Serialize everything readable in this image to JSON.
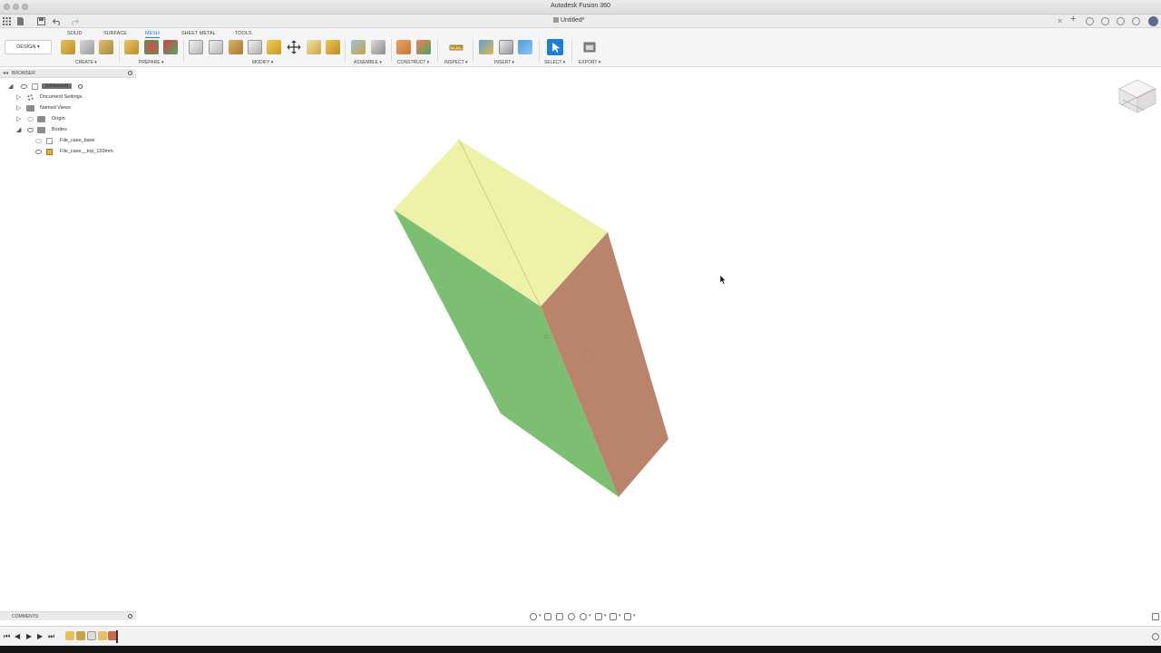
{
  "window": {
    "title": "Autodesk Fusion 360"
  },
  "document_tab": {
    "title": "Untitled*"
  },
  "workspace_tabs": [
    "SOLID",
    "SURFACE",
    "MESH",
    "SHEET METAL",
    "TOOLS"
  ],
  "active_workspace": "MESH",
  "workspace_button": "DESIGN ▾",
  "toolbar_groups": {
    "create": "CREATE ▾",
    "prepare": "PREPARE ▾",
    "modify": "MODIFY ▾",
    "assemble": "ASSEMBLE ▾",
    "construct": "CONSTRUCT ▾",
    "inspect": "INSPECT ▾",
    "insert": "INSERT ▾",
    "select": "SELECT ▾",
    "export": "EXPORT ▾"
  },
  "browser": {
    "title": "BROWSER",
    "root": "(Unsaved)",
    "items": [
      {
        "label": "Document Settings"
      },
      {
        "label": "Named Views"
      },
      {
        "label": "Origin"
      },
      {
        "label": "Bodies"
      }
    ],
    "bodies": [
      {
        "label": "File_case_base"
      },
      {
        "label": "File_case__top_120mm"
      }
    ]
  },
  "comments": {
    "title": "COMMENTS"
  },
  "colors": {
    "accent": "#1b7fd6",
    "face_top": "#eef2a8",
    "face_left": "#7cbe72",
    "face_right": "#b9836c"
  }
}
